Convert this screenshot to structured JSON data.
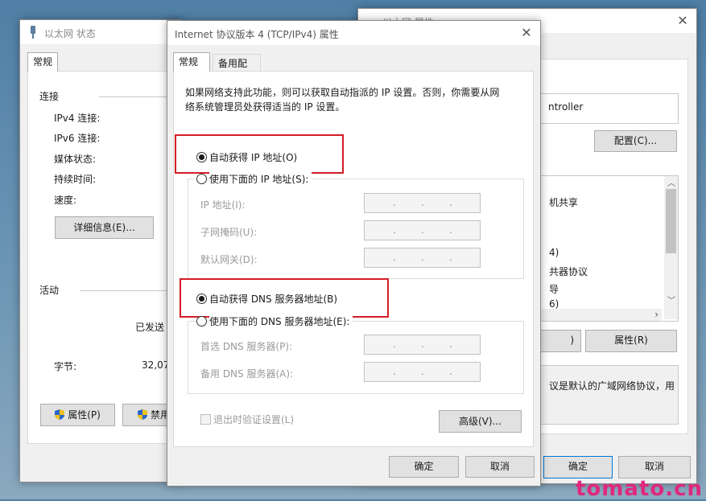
{
  "left_window": {
    "title": "以太网 状态",
    "tab_general": "常规",
    "section_connection": "连接",
    "ipv4": "IPv4 连接:",
    "ipv6": "IPv6 连接:",
    "media": "媒体状态:",
    "duration": "持续时间:",
    "speed": "速度:",
    "details_button": "详细信息(E)...",
    "section_activity": "活动",
    "sent": "已发送",
    "bytes_label": "字节:",
    "bytes_value": "32,07",
    "properties_button": "属性(P)",
    "disable_button": "禁用"
  },
  "right_window": {
    "title": "以太网 属性",
    "adapter_text": "ntroller",
    "configure_button": "配置(C)...",
    "list_items": [
      "机共享",
      "4)",
      "共器协议",
      "导",
      "6)"
    ],
    "left_btn_fragment": ")",
    "properties_button": "属性(R)",
    "description": "议是默认的广域网络协议，用",
    "ok_button": "确定",
    "cancel_button": "取消"
  },
  "dialog": {
    "title": "Internet 协议版本 4 (TCP/IPv4) 属性",
    "tab_general": "常规",
    "tab_alternate": "备用配置",
    "description_line1": "如果网络支持此功能，则可以获取自动指派的 IP 设置。否则，你需要从网",
    "description_line2": "络系统管理员处获得适当的 IP 设置。",
    "auto_ip": "自动获得 IP 地址(O)",
    "manual_ip": "使用下面的 IP 地址(S):",
    "ip_address": "IP 地址(I):",
    "subnet_mask": "子网掩码(U):",
    "gateway": "默认网关(D):",
    "auto_dns": "自动获得 DNS 服务器地址(B)",
    "manual_dns": "使用下面的 DNS 服务器地址(E):",
    "preferred_dns": "首选 DNS 服务器(P):",
    "alternate_dns": "备用 DNS 服务器(A):",
    "validate_on_exit": "退出时验证设置(L)",
    "advanced_button": "高级(V)...",
    "ok_button": "确定",
    "cancel_button": "取消",
    "ip_dot": "."
  },
  "watermark": "tomato.cn",
  "colors": {
    "highlight_box": "#d21e24",
    "watermark": "#e0287d",
    "primary_border": "#0078d7"
  }
}
